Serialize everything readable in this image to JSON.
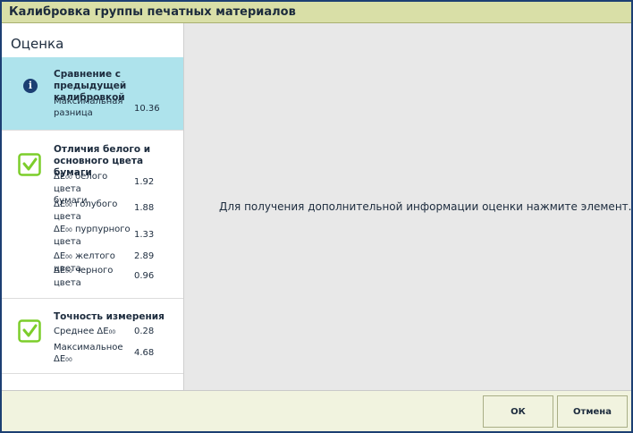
{
  "window": {
    "title": "Калибровка группы печатных материалов"
  },
  "sidebar": {
    "header": "Оценка",
    "cards": [
      {
        "icon": "info-icon",
        "title_line1": "Сравнение с предыдущей",
        "title_line2": "калибровкой",
        "rows": [
          {
            "label_line1": "Максимальная",
            "label_line2": "разница",
            "value": "10.36"
          }
        ]
      },
      {
        "icon": "checkmark-icon",
        "title_line1": "Отличия белого и",
        "title_line2": "основного цвета бумаги",
        "rows": [
          {
            "prefix": "ΔE",
            "sub": "00",
            "label_line1": " белого цвета",
            "label_line2": "бумаги",
            "value": "1.92"
          },
          {
            "prefix": "ΔE",
            "sub": "00",
            "label_line1": " голубого",
            "label_line2": "цвета",
            "value": "1.88"
          },
          {
            "prefix": "ΔE",
            "sub": "00",
            "label_line1": " пурпурного",
            "label_line2": "цвета",
            "value": "1.33"
          },
          {
            "prefix": "ΔE",
            "sub": "00",
            "label_line1": " желтого цвета",
            "value": "2.89"
          },
          {
            "prefix": "ΔE",
            "sub": "00",
            "label_line1": " черного",
            "label_line2": "цвета",
            "value": "0.96"
          }
        ]
      },
      {
        "icon": "checkmark-icon",
        "title_line1": "Точность измерения",
        "rows": [
          {
            "label_line1": "Среднее ΔE",
            "sub": "00",
            "value": "0.28"
          },
          {
            "label_line1": "Максимальное",
            "label_line2": "ΔE",
            "sub2": "00",
            "value": "4.68"
          }
        ]
      }
    ]
  },
  "main": {
    "message": "Для получения дополнительной информации оценки нажмите элемент."
  },
  "footer": {
    "ok_label": "ОК",
    "cancel_label": "Отмена"
  },
  "colors": {
    "accent_dark": "#1c3f73",
    "title_bar": "#d9dfa7",
    "selected": "#aee3ec",
    "check_green": "#7ccd2a",
    "main_bg": "#e8e8e8",
    "footer_bg": "#f1f3df"
  }
}
